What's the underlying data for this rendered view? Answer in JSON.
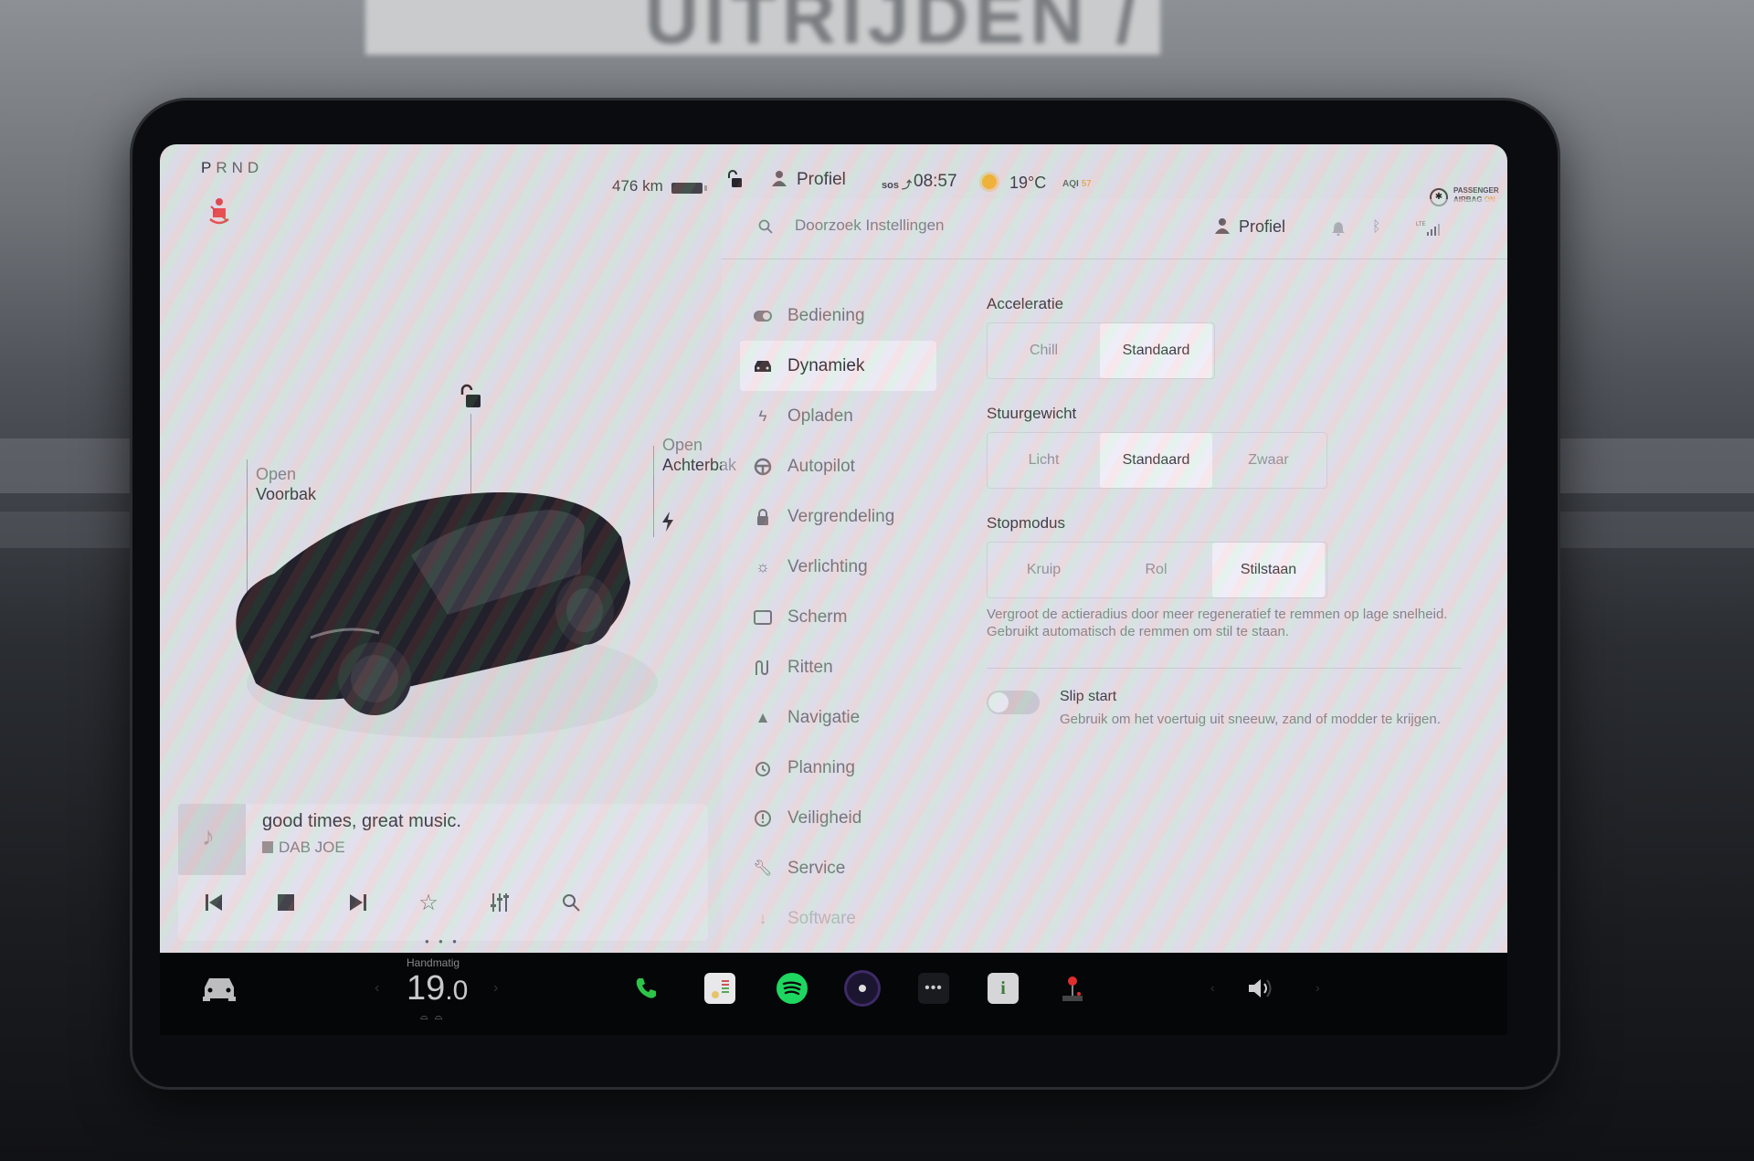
{
  "background": {
    "sign_text": "UITRIJDEN / INGANG"
  },
  "left_panel": {
    "gear": {
      "letters": [
        "P",
        "R",
        "N",
        "D"
      ],
      "active": "P"
    },
    "range": "476 km",
    "battery_level_pct": 85,
    "callouts": {
      "frunk": {
        "action": "Open",
        "label": "Voorbak"
      },
      "trunk": {
        "action": "Open",
        "label": "Achterbak"
      }
    },
    "icons": {
      "seatbelt": "seatbelt-warning-icon",
      "lock": "unlock-icon",
      "charge_port": "lightning-icon"
    },
    "media": {
      "track": "good times, great music.",
      "station": "DAB JOE",
      "controls": [
        "previous",
        "stop",
        "next",
        "favorite",
        "equalizer",
        "search"
      ],
      "page_dots": 3,
      "active_page": 1
    }
  },
  "status_bar": {
    "profile": "Profiel",
    "sos": "SOS",
    "time": "08:57",
    "temperature": "19°C",
    "aqi_label": "AQI",
    "aqi_value": "57",
    "airbag_line1": "PASSENGER",
    "airbag_line2": "AIRBAG",
    "airbag_state": "ON",
    "accent_color": "#e5a94a"
  },
  "settings": {
    "search": {
      "placeholder": "Doorzoek Instellingen",
      "value": ""
    },
    "header_profile": "Profiel",
    "nav": [
      {
        "label": "Bediening",
        "icon": "toggle-icon"
      },
      {
        "label": "Dynamiek",
        "icon": "car-icon",
        "active": true
      },
      {
        "label": "Opladen",
        "icon": "lightning-icon"
      },
      {
        "label": "Autopilot",
        "icon": "steering-wheel-icon"
      },
      {
        "label": "Vergrendeling",
        "icon": "lock-icon"
      },
      {
        "label": "Verlichting",
        "icon": "sun-icon"
      },
      {
        "label": "Scherm",
        "icon": "display-icon"
      },
      {
        "label": "Ritten",
        "icon": "trips-icon"
      },
      {
        "label": "Navigatie",
        "icon": "navigation-arrow-icon"
      },
      {
        "label": "Planning",
        "icon": "alarm-clock-icon"
      },
      {
        "label": "Veiligheid",
        "icon": "alert-circle-icon"
      },
      {
        "label": "Service",
        "icon": "wrench-icon"
      },
      {
        "label": "Software",
        "icon": "download-icon"
      }
    ],
    "sections": {
      "acceleration": {
        "title": "Acceleratie",
        "options": [
          "Chill",
          "Standaard"
        ],
        "selected": "Standaard"
      },
      "steering": {
        "title": "Stuurgewicht",
        "options": [
          "Licht",
          "Standaard",
          "Zwaar"
        ],
        "selected": "Standaard"
      },
      "stop_mode": {
        "title": "Stopmodus",
        "options": [
          "Kruip",
          "Rol",
          "Stilstaan"
        ],
        "selected": "Stilstaan",
        "description": "Vergroot de actieradius door meer regeneratief te remmen op lage snelheid. Gebruikt automatisch de remmen om stil te staan."
      },
      "slip_start": {
        "title": "Slip start",
        "enabled": false,
        "description": "Gebruik om het voertuig uit sneeuw, zand of modder te krijgen."
      }
    }
  },
  "dock": {
    "hvac_mode": "Handmatig",
    "hvac_temp_int": "19",
    "hvac_temp_dec": ".0",
    "apps": [
      "phone-app",
      "calendar-app",
      "spotify-app",
      "camera-app",
      "more-apps",
      "manual-app",
      "toybox-app"
    ],
    "volume_icon": "speaker-icon"
  }
}
